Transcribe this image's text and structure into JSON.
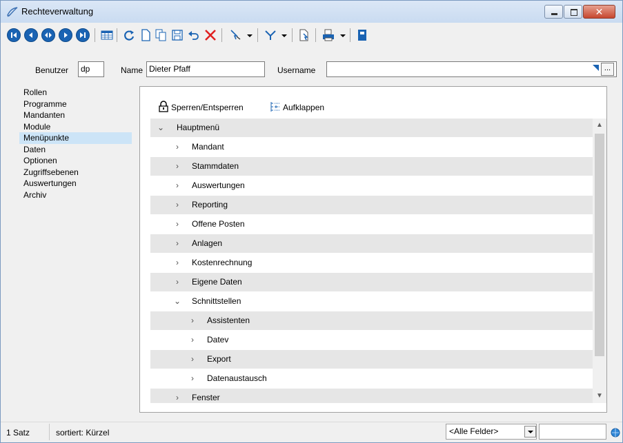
{
  "window": {
    "title": "Rechteverwaltung"
  },
  "toolbar": {
    "icons": [
      "first-record-icon",
      "prev-record-icon",
      "goto-record-icon",
      "next-record-icon",
      "last-record-icon",
      "grid-view-icon",
      "refresh-icon",
      "new-icon",
      "copy-icon",
      "save-icon",
      "undo-icon",
      "delete-icon",
      "select-icon",
      "filter-icon",
      "export-icon",
      "print-icon",
      "help-book-icon"
    ]
  },
  "header": {
    "benutzer_label": "Benutzer",
    "benutzer_value": "dp",
    "name_label": "Name",
    "name_value": "Dieter Pfaff",
    "username_label": "Username",
    "username_value": "",
    "username_button": "..."
  },
  "sidebar": {
    "items": [
      {
        "label": "Rollen"
      },
      {
        "label": "Programme"
      },
      {
        "label": "Mandanten"
      },
      {
        "label": "Module"
      },
      {
        "label": "Menüpunkte",
        "selected": true
      },
      {
        "label": "Daten"
      },
      {
        "label": "Optionen"
      },
      {
        "label": "Zugriffsebenen"
      },
      {
        "label": "Auswertungen"
      },
      {
        "label": "Archiv"
      }
    ]
  },
  "panel": {
    "lock_label": "Sperren/Entsperren",
    "expand_label": "Aufklappen"
  },
  "tree": {
    "rows": [
      {
        "label": "Hauptmenü",
        "level": 0,
        "expanded": true
      },
      {
        "label": "Mandant",
        "level": 1,
        "expanded": false
      },
      {
        "label": "Stammdaten",
        "level": 1,
        "expanded": false
      },
      {
        "label": "Auswertungen",
        "level": 1,
        "expanded": false
      },
      {
        "label": "Reporting",
        "level": 1,
        "expanded": false
      },
      {
        "label": "Offene Posten",
        "level": 1,
        "expanded": false
      },
      {
        "label": "Anlagen",
        "level": 1,
        "expanded": false
      },
      {
        "label": "Kostenrechnung",
        "level": 1,
        "expanded": false
      },
      {
        "label": "Eigene Daten",
        "level": 1,
        "expanded": false
      },
      {
        "label": "Schnittstellen",
        "level": 1,
        "expanded": true
      },
      {
        "label": "Assistenten",
        "level": 2,
        "expanded": false
      },
      {
        "label": "Datev",
        "level": 2,
        "expanded": false
      },
      {
        "label": "Export",
        "level": 2,
        "expanded": false
      },
      {
        "label": "Datenaustausch",
        "level": 2,
        "expanded": false
      },
      {
        "label": "Fenster",
        "level": 1,
        "expanded": false
      }
    ]
  },
  "status": {
    "count": "1 Satz",
    "sorted": "sortiert: Kürzel",
    "field_filter": "<Alle Felder>"
  },
  "colors": {
    "selected_row": "#cce4f7",
    "nav_button": "#1a63b3",
    "delete_icon": "#e02020"
  }
}
